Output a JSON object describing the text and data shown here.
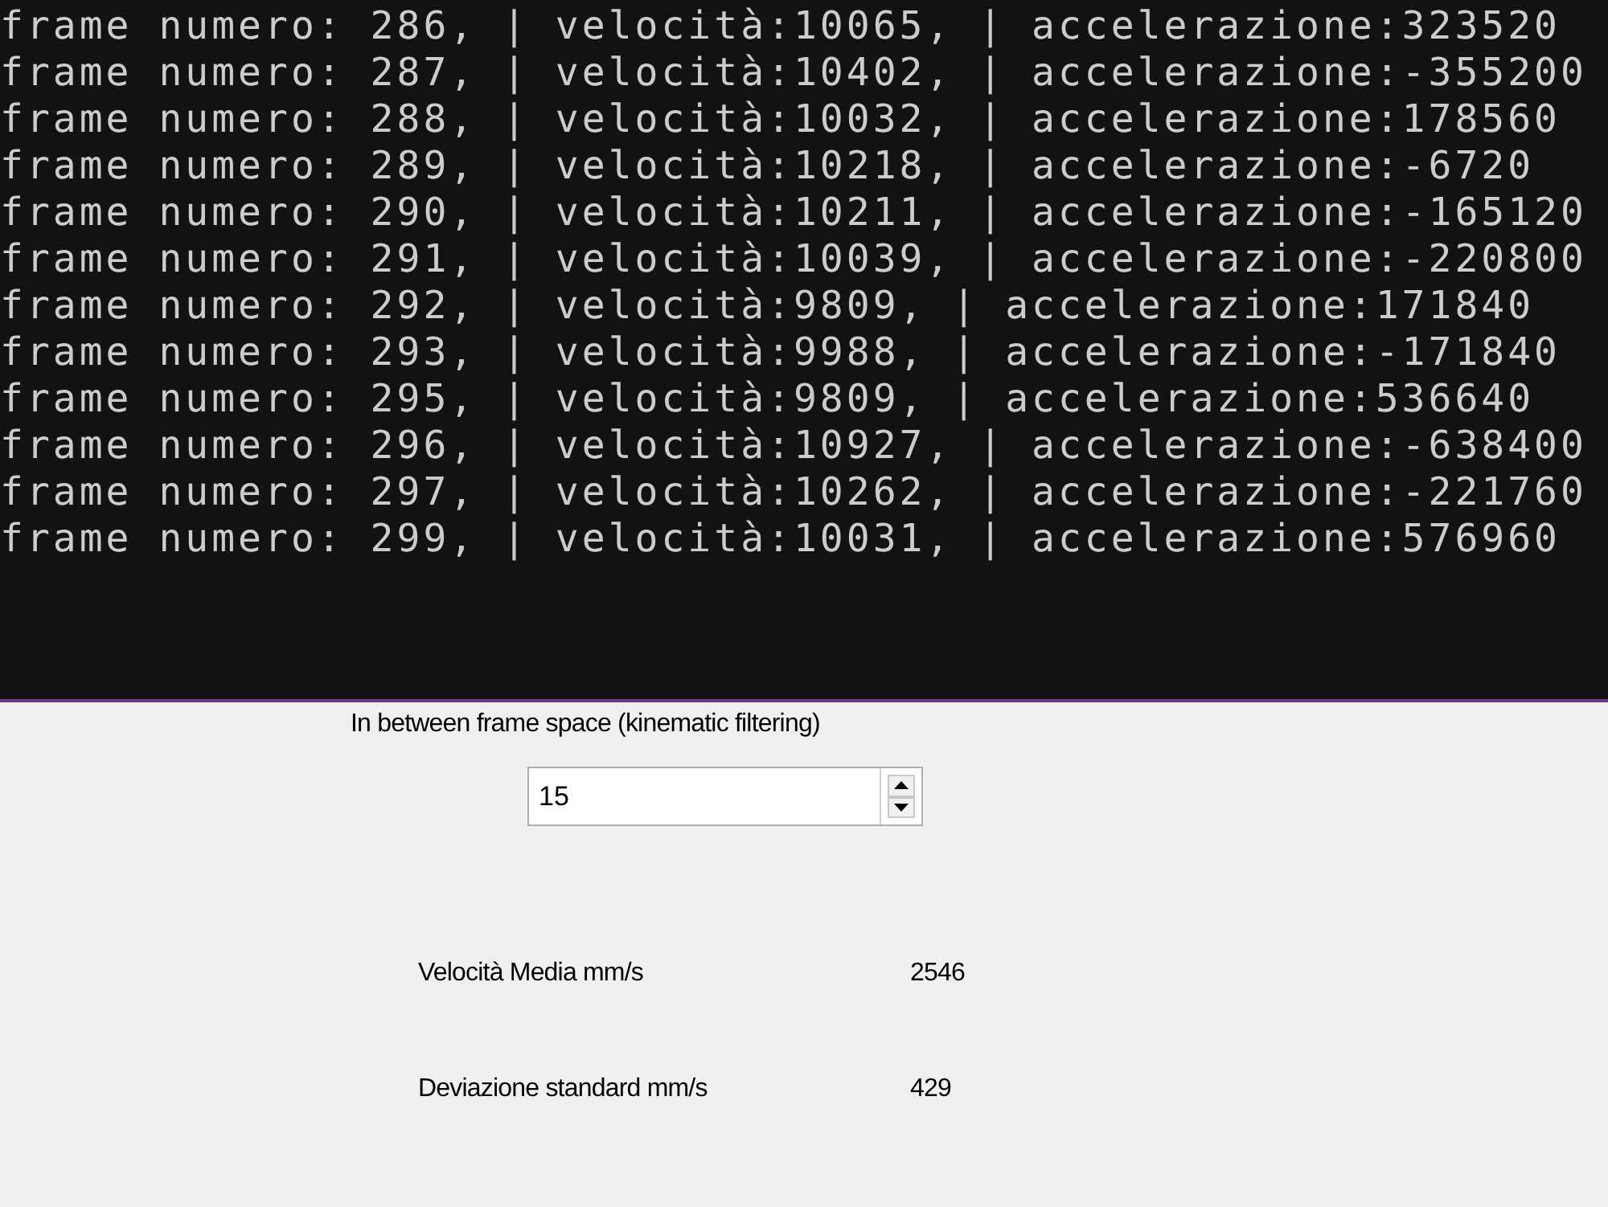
{
  "console": {
    "lines": [
      "frame numero: 286, | velocità:10065, | accelerazione:323520",
      "frame numero: 287, | velocità:10402, | accelerazione:-355200",
      "frame numero: 288, | velocità:10032, | accelerazione:178560",
      "frame numero: 289, | velocità:10218, | accelerazione:-6720",
      "frame numero: 290, | velocità:10211, | accelerazione:-165120",
      "frame numero: 291, | velocità:10039, | accelerazione:-220800",
      "frame numero: 292, | velocità:9809, | accelerazione:171840",
      "frame numero: 293, | velocità:9988, | accelerazione:-171840",
      "frame numero: 295, | velocità:9809, | accelerazione:536640",
      "frame numero: 296, | velocità:10927, | accelerazione:-638400",
      "frame numero: 297, | velocità:10262, | accelerazione:-221760",
      "frame numero: 299, | velocità:10031, | accelerazione:576960"
    ]
  },
  "spinner": {
    "label": "In between frame space (kinematic filtering)",
    "value": "15"
  },
  "stats": [
    {
      "label": "Velocità Media mm/s",
      "value": "2546"
    },
    {
      "label": "Deviazione standard mm/s",
      "value": "429"
    }
  ]
}
